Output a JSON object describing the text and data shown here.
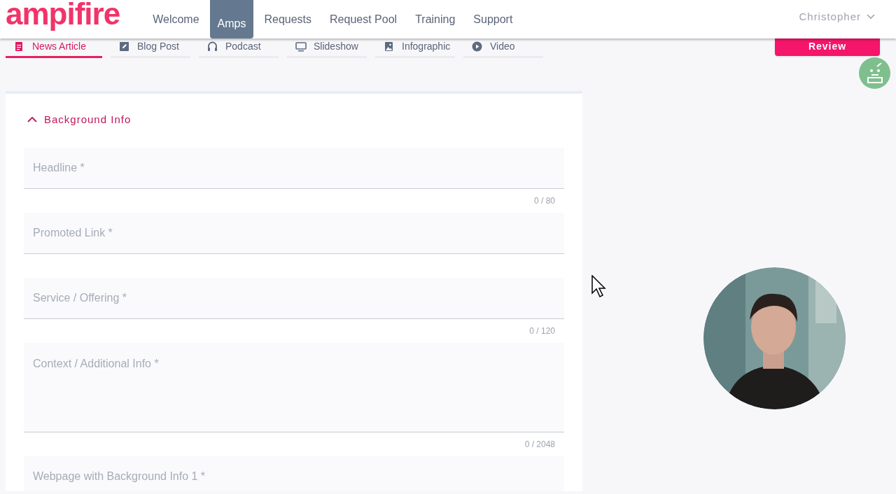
{
  "logo": "ampifire",
  "nav": [
    {
      "label": "Welcome",
      "selected": false
    },
    {
      "label": "Amps",
      "selected": true
    },
    {
      "label": "Requests",
      "selected": false
    },
    {
      "label": "Request Pool",
      "selected": false
    },
    {
      "label": "Training",
      "selected": false
    },
    {
      "label": "Support",
      "selected": false
    }
  ],
  "user_menu": "Christopher",
  "content_tabs": [
    {
      "label": "News Article",
      "selected": true
    },
    {
      "label": "Blog Post",
      "selected": false
    },
    {
      "label": "Podcast",
      "selected": false
    },
    {
      "label": "Slideshow",
      "selected": false
    },
    {
      "label": "Infographic",
      "selected": false
    },
    {
      "label": "Video",
      "selected": false
    }
  ],
  "review_button": "Review",
  "section": {
    "title": "Background Info",
    "expanded": true
  },
  "fields": [
    {
      "kind": "input",
      "placeholder": "Headline *",
      "counter": "0 / 80"
    },
    {
      "kind": "input",
      "placeholder": "Promoted Link *"
    },
    {
      "kind": "input",
      "placeholder": "Service / Offering *",
      "counter": "0 / 120"
    },
    {
      "kind": "textarea",
      "placeholder": "Context / Additional Info *",
      "counter": "0 / 2048"
    },
    {
      "kind": "input",
      "placeholder": "Webpage with Background Info 1 *"
    }
  ]
}
